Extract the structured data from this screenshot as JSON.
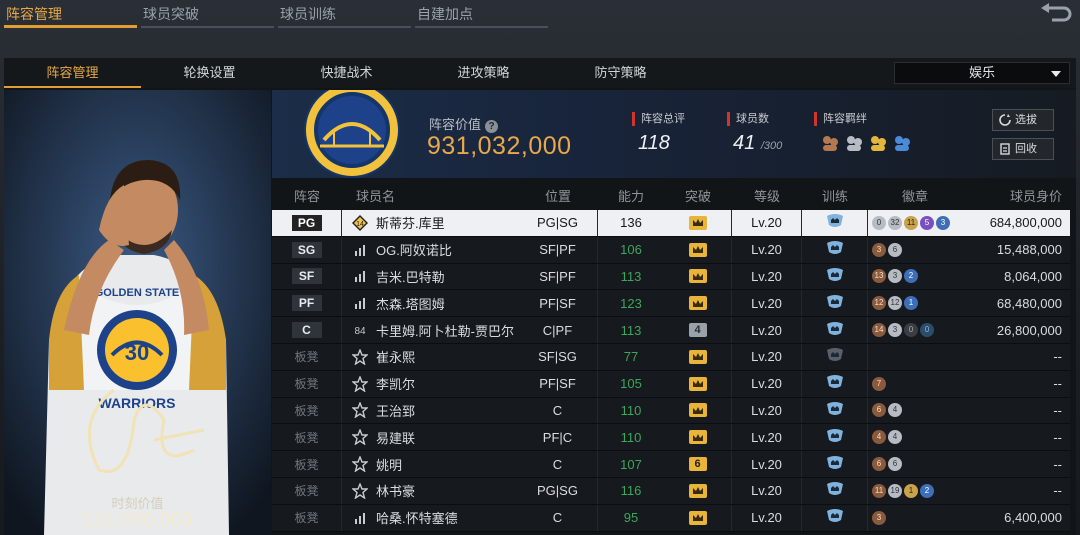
{
  "top_tabs": [
    {
      "label": "阵容管理",
      "active": true
    },
    {
      "label": "球员突破",
      "active": false
    },
    {
      "label": "球员训练",
      "active": false
    },
    {
      "label": "自建加点",
      "active": false
    }
  ],
  "sub_tabs": [
    {
      "label": "阵容管理",
      "active": true
    },
    {
      "label": "轮换设置",
      "active": false
    },
    {
      "label": "快捷战术",
      "active": false
    },
    {
      "label": "进攻策略",
      "active": false
    },
    {
      "label": "防守策略",
      "active": false
    }
  ],
  "mode_select": {
    "value": "娱乐"
  },
  "player_card": {
    "moment_label": "时刻价值",
    "moment_value": "121,000,000",
    "jersey_text": "GOLDEN STATE",
    "jersey_number": "30",
    "jersey_team": "WARRIORS"
  },
  "team_header": {
    "lineup_label": "阵容价值",
    "lineup_value": "931,032,000",
    "stats": [
      {
        "label": "阵容总评",
        "value": "118",
        "suffix": ""
      },
      {
        "label": "球员数",
        "value": "41",
        "suffix": "/300"
      },
      {
        "label": "阵容羁绊",
        "value": "",
        "suffix": ""
      }
    ],
    "buttons": {
      "pick": "选拔",
      "recycle": "回收"
    }
  },
  "table": {
    "headers": {
      "pos": "阵容",
      "name": "球员名",
      "role": "位置",
      "ability": "能力",
      "breakthrough": "突破",
      "level": "等级",
      "training": "训练",
      "badges": "徽章",
      "value": "球员身价"
    },
    "rows": [
      {
        "pos": "PG",
        "bench": false,
        "icon": "medal-14",
        "name": "斯蒂芬.库里",
        "role": "PG|SG",
        "ability": "136",
        "brk": "crown",
        "level": "Lv.20",
        "train": "shield",
        "badges": [
          [
            "s",
            "0"
          ],
          [
            "s",
            "32"
          ],
          [
            "g",
            "11"
          ],
          [
            "p",
            "5"
          ],
          [
            "bl",
            "3"
          ]
        ],
        "value": "684,800,000",
        "selected": true
      },
      {
        "pos": "SG",
        "bench": false,
        "icon": "bars",
        "name": "OG.阿奴诺比",
        "role": "SF|PF",
        "ability": "106",
        "brk": "crown",
        "level": "Lv.20",
        "train": "shield",
        "badges": [
          [
            "b",
            "3"
          ],
          [
            "s",
            "6"
          ]
        ],
        "value": "15,488,000"
      },
      {
        "pos": "SF",
        "bench": false,
        "icon": "bars",
        "name": "吉米.巴特勒",
        "role": "SF|PF",
        "ability": "113",
        "brk": "crown",
        "level": "Lv.20",
        "train": "shield",
        "badges": [
          [
            "b",
            "13"
          ],
          [
            "s",
            "3"
          ],
          [
            "bl",
            "2"
          ]
        ],
        "value": "8,064,000"
      },
      {
        "pos": "PF",
        "bench": false,
        "icon": "bars",
        "name": "杰森.塔图姆",
        "role": "PF|SF",
        "ability": "123",
        "brk": "crown",
        "level": "Lv.20",
        "train": "shield",
        "badges": [
          [
            "b",
            "12"
          ],
          [
            "s",
            "12"
          ],
          [
            "bl",
            "1"
          ]
        ],
        "value": "68,480,000"
      },
      {
        "pos": "C",
        "bench": false,
        "icon": "num-84",
        "name": "卡里姆.阿卜杜勒-贾巴尔",
        "role": "C|PF",
        "ability": "113",
        "brk": "4",
        "level": "Lv.20",
        "train": "shield",
        "badges": [
          [
            "b",
            "14"
          ],
          [
            "s",
            "3"
          ],
          [
            "d",
            "0"
          ],
          [
            "t",
            "0"
          ]
        ],
        "value": "26,800,000"
      },
      {
        "pos": "板凳",
        "bench": true,
        "icon": "star",
        "name": "崔永熙",
        "role": "SF|SG",
        "ability": "77",
        "brk": "crown",
        "level": "Lv.20",
        "train": "shield-grey",
        "badges": [],
        "value": "--"
      },
      {
        "pos": "板凳",
        "bench": true,
        "icon": "star",
        "name": "李凯尔",
        "role": "PF|SF",
        "ability": "105",
        "brk": "crown",
        "level": "Lv.20",
        "train": "shield",
        "badges": [
          [
            "b",
            "7"
          ]
        ],
        "value": "--"
      },
      {
        "pos": "板凳",
        "bench": true,
        "icon": "star",
        "name": "王治郅",
        "role": "C",
        "ability": "110",
        "brk": "crown",
        "level": "Lv.20",
        "train": "shield",
        "badges": [
          [
            "b",
            "6"
          ],
          [
            "s",
            "4"
          ]
        ],
        "value": "--"
      },
      {
        "pos": "板凳",
        "bench": true,
        "icon": "star",
        "name": "易建联",
        "role": "PF|C",
        "ability": "110",
        "brk": "crown",
        "level": "Lv.20",
        "train": "shield",
        "badges": [
          [
            "b",
            "4"
          ],
          [
            "s",
            "4"
          ]
        ],
        "value": "--"
      },
      {
        "pos": "板凳",
        "bench": true,
        "icon": "star",
        "name": "姚明",
        "role": "C",
        "ability": "107",
        "brk": "6",
        "level": "Lv.20",
        "train": "shield",
        "badges": [
          [
            "b",
            "6"
          ],
          [
            "s",
            "6"
          ]
        ],
        "value": "--"
      },
      {
        "pos": "板凳",
        "bench": true,
        "icon": "star",
        "name": "林书豪",
        "role": "PG|SG",
        "ability": "116",
        "brk": "crown",
        "level": "Lv.20",
        "train": "shield",
        "badges": [
          [
            "b",
            "11"
          ],
          [
            "s",
            "19"
          ],
          [
            "g",
            "1"
          ],
          [
            "bl",
            "2"
          ]
        ],
        "value": "--"
      },
      {
        "pos": "板凳",
        "bench": true,
        "icon": "bars",
        "name": "哈桑.怀特塞德",
        "role": "C",
        "ability": "95",
        "brk": "crown",
        "level": "Lv.20",
        "train": "shield",
        "badges": [
          [
            "b",
            "3"
          ]
        ],
        "value": "6,400,000"
      }
    ]
  }
}
